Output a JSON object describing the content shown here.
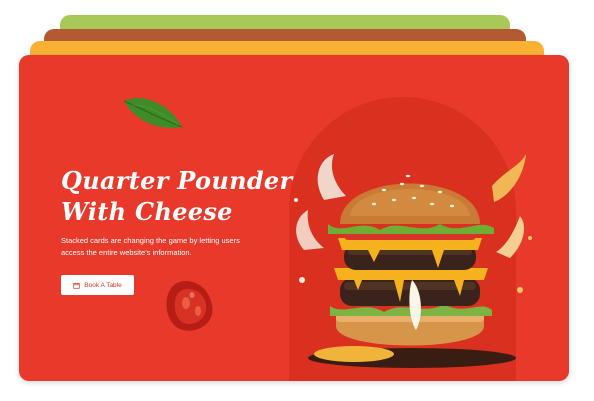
{
  "hero": {
    "title_line1": "Quarter Pounder",
    "title_line2": "With Cheese",
    "description": "Stacked cards are changing the game by letting users access the entire website's information.",
    "cta_label": "Book A Table",
    "cta_icon": "calendar-icon"
  },
  "cards": [
    {
      "name": "back-card",
      "color": "#a8c957"
    },
    {
      "name": "middle-card",
      "color": "#b45a33"
    },
    {
      "name": "front-back-card",
      "color": "#f8b133"
    },
    {
      "name": "main-card",
      "color": "#e9392b"
    }
  ],
  "illustrations": [
    "basil-leaf",
    "tomato-slice",
    "cheeseburger"
  ]
}
